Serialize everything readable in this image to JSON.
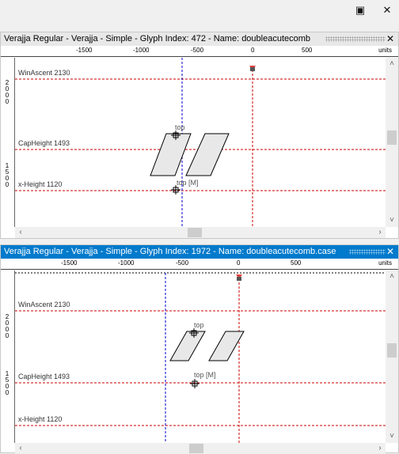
{
  "window": {
    "restore_icon": "maximize-icon",
    "close_icon": "close-icon",
    "restore_glyph": "▣",
    "close_glyph": "✕"
  },
  "ruler": {
    "ticks": [
      "-1500",
      "-1000",
      "-500",
      "0",
      "500"
    ],
    "units": "units"
  },
  "panels": [
    {
      "title": "Verajja Regular - Verajja - Simple - Glyph Index: 472 - Name: doubleacutecomb",
      "active": false,
      "metrics": {
        "win_ascent": "WinAscent 2130",
        "cap_height": "CapHeight 1493",
        "x_height": "x-Height 1120"
      },
      "vruler_labels": [
        "2000",
        "1500"
      ],
      "anchors": [
        {
          "label": "top"
        },
        {
          "label": "top [M]"
        }
      ]
    },
    {
      "title": "Verajja Regular - Verajja - Simple - Glyph Index: 1972 - Name: doubleacutecomb.case",
      "active": true,
      "metrics": {
        "win_ascent": "WinAscent 2130",
        "cap_height": "CapHeight 1493",
        "x_height": "x-Height 1120"
      },
      "vruler_labels": [
        "2000",
        "1500"
      ],
      "anchors": [
        {
          "label": "top"
        },
        {
          "label": "top [M]"
        }
      ]
    }
  ],
  "colors": {
    "metric_line": "#cc0000",
    "baseline_guide": "#0000cc",
    "active_title": "#007acc",
    "glyph_fill": "#e8e8e8"
  }
}
